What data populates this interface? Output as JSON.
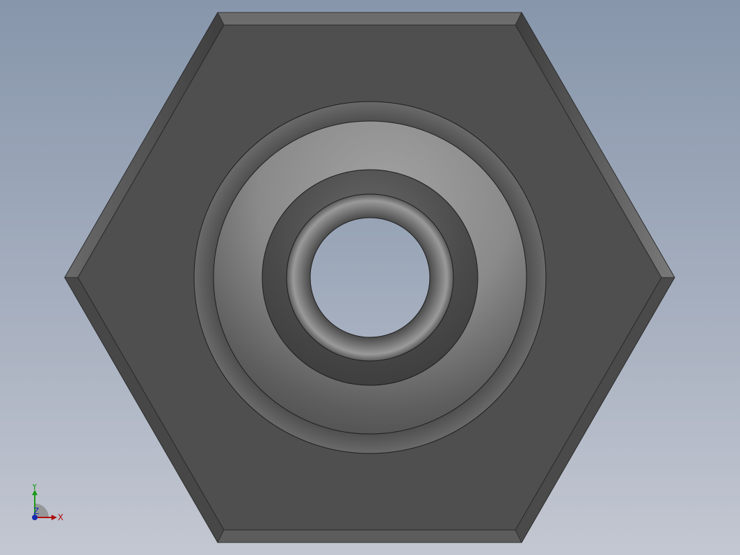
{
  "viewport": {
    "background_top": "#8796ab",
    "background_bottom": "#c3c7d1",
    "view": "front"
  },
  "part": {
    "type": "hex-nut",
    "face_color": "#4f4f4f",
    "chamfer_color": "#5e5e5e",
    "bore": "through-hole"
  },
  "triad": {
    "x_label": "X",
    "y_label": "Y",
    "z_label": "Z",
    "x_color": "#b01010",
    "y_color": "#1a9a1a",
    "z_color": "#1a2ab0"
  }
}
